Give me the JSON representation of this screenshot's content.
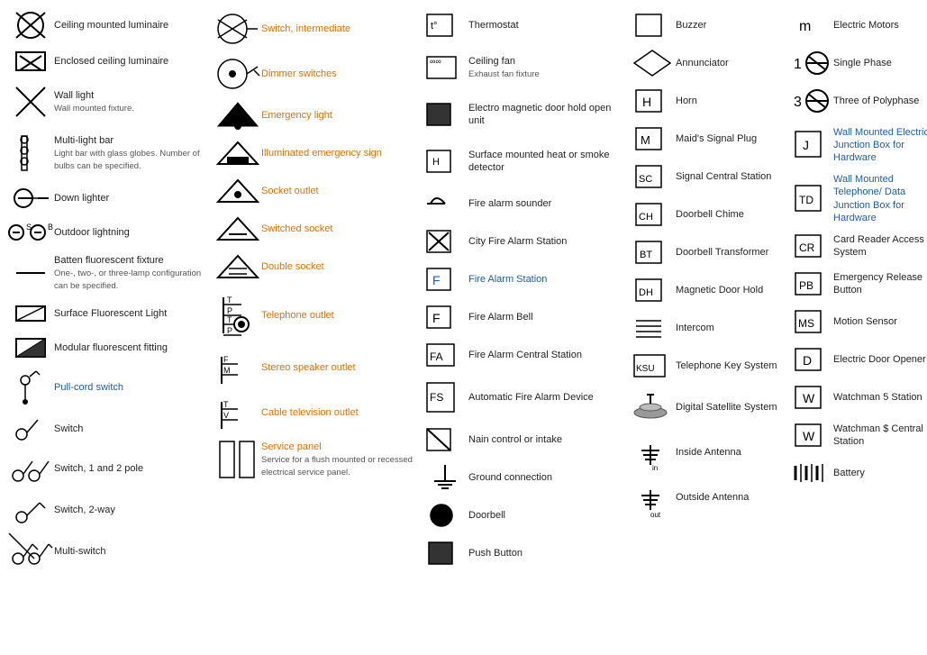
{
  "columns": [
    {
      "id": "col1",
      "items": [
        {
          "id": "ceiling-luminaire",
          "label": "Ceiling mounted luminaire",
          "sub": "",
          "labelColor": "black",
          "symbolType": "x-circle"
        },
        {
          "id": "enclosed-ceiling",
          "label": "Enclosed ceiling luminaire",
          "sub": "",
          "labelColor": "black",
          "symbolType": "x-rect"
        },
        {
          "id": "wall-light",
          "label": "Wall light",
          "sub": "Wall mounted fixture.",
          "labelColor": "black",
          "symbolType": "wall-light"
        },
        {
          "id": "multi-light-bar",
          "label": "Multi-light bar",
          "sub": "Light bar with glass globes. Number of bulbs can be specified.",
          "labelColor": "black",
          "symbolType": "multi-light"
        },
        {
          "id": "down-lighter",
          "label": "Down lighter",
          "sub": "",
          "labelColor": "black",
          "symbolType": "down-lighter"
        },
        {
          "id": "outdoor-lightning",
          "label": "Outdoor lightning",
          "sub": "",
          "labelColor": "black",
          "symbolType": "outdoor"
        },
        {
          "id": "batten-fluorescent",
          "label": "Batten fluorescent fixture",
          "sub": "One-, two-, or three-lamp configuration can be specified.",
          "labelColor": "black",
          "symbolType": "batten"
        },
        {
          "id": "surface-fluorescent",
          "label": "Surface Fluorescent Light",
          "sub": "",
          "labelColor": "black",
          "symbolType": "surface-fluor"
        },
        {
          "id": "modular-fluorescent",
          "label": "Modular fluorescent fitting",
          "sub": "",
          "labelColor": "black",
          "symbolType": "modular-fluor"
        },
        {
          "id": "pull-cord",
          "label": "Pull-cord switch",
          "sub": "",
          "labelColor": "blue",
          "symbolType": "pull-cord"
        },
        {
          "id": "switch",
          "label": "Switch",
          "sub": "",
          "labelColor": "black",
          "symbolType": "switch-single"
        },
        {
          "id": "switch-1-2-pole",
          "label": "Switch, 1 and 2 pole",
          "sub": "",
          "labelColor": "black",
          "symbolType": "switch-1-2"
        },
        {
          "id": "switch-2way",
          "label": "Switch, 2-way",
          "sub": "",
          "labelColor": "black",
          "symbolType": "switch-2way"
        },
        {
          "id": "multi-switch",
          "label": "Multi-switch",
          "sub": "",
          "labelColor": "black",
          "symbolType": "multi-switch"
        }
      ]
    },
    {
      "id": "col2",
      "items": [
        {
          "id": "switch-intermediate",
          "label": "Switch, intermediate",
          "sub": "",
          "labelColor": "orange",
          "symbolType": "switch-intermediate"
        },
        {
          "id": "dimmer-switches",
          "label": "Dimmer switches",
          "sub": "",
          "labelColor": "orange",
          "symbolType": "dimmer"
        },
        {
          "id": "emergency-light",
          "label": "Emergency light",
          "sub": "",
          "labelColor": "orange",
          "symbolType": "emergency-light"
        },
        {
          "id": "illuminated-emergency",
          "label": "Illuminated emergency sign",
          "sub": "",
          "labelColor": "orange",
          "symbolType": "illuminated-emergency"
        },
        {
          "id": "socket-outlet",
          "label": "Socket outlet",
          "sub": "",
          "labelColor": "orange",
          "symbolType": "socket-outlet"
        },
        {
          "id": "switched-socket",
          "label": "Switched socket",
          "sub": "",
          "labelColor": "orange",
          "symbolType": "switched-socket"
        },
        {
          "id": "double-socket",
          "label": "Double socket",
          "sub": "",
          "labelColor": "orange",
          "symbolType": "double-socket"
        },
        {
          "id": "telephone-outlet",
          "label": "Telephone outlet",
          "sub": "",
          "labelColor": "orange",
          "symbolType": "telephone-outlet"
        },
        {
          "id": "stereo-speaker",
          "label": "Stereo speaker outlet",
          "sub": "",
          "labelColor": "orange",
          "symbolType": "stereo-speaker"
        },
        {
          "id": "cable-tv",
          "label": "Cable television outlet",
          "sub": "",
          "labelColor": "orange",
          "symbolType": "cable-tv"
        },
        {
          "id": "service-panel",
          "label": "Service panel",
          "sub": "Service for a flush mounted or recessed electrical service panel.",
          "labelColor": "orange",
          "symbolType": "service-panel"
        }
      ]
    },
    {
      "id": "col3",
      "items": [
        {
          "id": "thermostat",
          "label": "Thermostat",
          "sub": "",
          "labelColor": "black",
          "symbolType": "thermostat"
        },
        {
          "id": "ceiling-fan",
          "label": "Ceiling fan",
          "sub": "Exhaust fan fixture",
          "labelColor": "black",
          "symbolType": "ceiling-fan"
        },
        {
          "id": "electro-magnetic",
          "label": "Electro magnetic door hold open unit",
          "sub": "",
          "labelColor": "black",
          "symbolType": "electro-magnetic"
        },
        {
          "id": "surface-heat-smoke",
          "label": "Surface mounted heat or smoke detector",
          "sub": "",
          "labelColor": "black",
          "symbolType": "surface-heat"
        },
        {
          "id": "fire-alarm-sounder",
          "label": "Fire alarm sounder",
          "sub": "",
          "labelColor": "black",
          "symbolType": "fire-alarm-sounder"
        },
        {
          "id": "city-fire-alarm",
          "label": "City Fire Alarm Station",
          "sub": "",
          "labelColor": "black",
          "symbolType": "city-fire"
        },
        {
          "id": "fire-alarm-station",
          "label": "Fire Alarm Station",
          "sub": "",
          "labelColor": "blue",
          "symbolType": "fire-station"
        },
        {
          "id": "fire-alarm-bell",
          "label": "Fire Alarm Bell",
          "sub": "",
          "labelColor": "black",
          "symbolType": "fire-bell"
        },
        {
          "id": "fire-alarm-central",
          "label": "Fire Alarm Central Station",
          "sub": "",
          "labelColor": "black",
          "symbolType": "fire-central"
        },
        {
          "id": "auto-fire-alarm",
          "label": "Automatic Fire Alarm Device",
          "sub": "",
          "labelColor": "black",
          "symbolType": "auto-fire"
        },
        {
          "id": "main-control",
          "label": "Nain control or intake",
          "sub": "",
          "labelColor": "black",
          "symbolType": "main-control"
        },
        {
          "id": "ground-connection",
          "label": "Ground connection",
          "sub": "",
          "labelColor": "black",
          "symbolType": "ground"
        },
        {
          "id": "doorbell",
          "label": "Doorbell",
          "sub": "",
          "labelColor": "black",
          "symbolType": "doorbell"
        },
        {
          "id": "push-button",
          "label": "Push Button",
          "sub": "",
          "labelColor": "black",
          "symbolType": "push-button"
        }
      ]
    },
    {
      "id": "col4",
      "items": [
        {
          "id": "buzzer",
          "label": "Buzzer",
          "sub": "",
          "labelColor": "black",
          "symbolType": "buzzer"
        },
        {
          "id": "annunciator",
          "label": "Annunciator",
          "sub": "",
          "labelColor": "black",
          "symbolType": "annunciator"
        },
        {
          "id": "horn",
          "label": "Horn",
          "sub": "",
          "labelColor": "black",
          "symbolType": "horn"
        },
        {
          "id": "maids-signal",
          "label": "Maid's Signal Plug",
          "sub": "",
          "labelColor": "black",
          "symbolType": "maids-signal"
        },
        {
          "id": "signal-central",
          "label": "Signal Central Station",
          "sub": "",
          "labelColor": "black",
          "symbolType": "signal-central"
        },
        {
          "id": "doorbell-chime",
          "label": "Doorbell Chime",
          "sub": "",
          "labelColor": "black",
          "symbolType": "doorbell-chime"
        },
        {
          "id": "doorbell-transformer",
          "label": "Doorbell Transformer",
          "sub": "",
          "labelColor": "black",
          "symbolType": "doorbell-transformer"
        },
        {
          "id": "magnetic-door",
          "label": "Magnetic Door Hold",
          "sub": "",
          "labelColor": "black",
          "symbolType": "magnetic-door"
        },
        {
          "id": "intercom",
          "label": "Intercom",
          "sub": "",
          "labelColor": "black",
          "symbolType": "intercom"
        },
        {
          "id": "telephone-key",
          "label": "Telephone Key System",
          "sub": "",
          "labelColor": "black",
          "symbolType": "telephone-key"
        },
        {
          "id": "digital-satellite",
          "label": "Digital Satellite System",
          "sub": "",
          "labelColor": "black",
          "symbolType": "digital-satellite"
        },
        {
          "id": "inside-antenna",
          "label": "Inside Antenna",
          "sub": "",
          "labelColor": "black",
          "symbolType": "inside-antenna"
        },
        {
          "id": "outside-antenna",
          "label": "Outside Antenna",
          "sub": "",
          "labelColor": "black",
          "symbolType": "outside-antenna"
        }
      ]
    },
    {
      "id": "col5",
      "items": [
        {
          "id": "electric-motors",
          "label": "Electric Motors",
          "sub": "",
          "labelColor": "black",
          "symbolType": "electric-motors"
        },
        {
          "id": "single-phase",
          "label": "Single Phase",
          "sub": "",
          "labelColor": "black",
          "symbolType": "single-phase"
        },
        {
          "id": "three-polyphase",
          "label": "Three of Polyphase",
          "sub": "",
          "labelColor": "black",
          "symbolType": "three-polyphase"
        },
        {
          "id": "wall-junction-hardware",
          "label": "Wall Mounted Electrical Junction Box for Hardware",
          "sub": "",
          "labelColor": "blue",
          "symbolType": "wall-junction-j"
        },
        {
          "id": "wall-telephone-data",
          "label": "Wall Mounted Telephone/ Data Junction Box for Hardware",
          "sub": "",
          "labelColor": "blue",
          "symbolType": "wall-junction-td"
        },
        {
          "id": "card-reader",
          "label": "Card Reader Access System",
          "sub": "",
          "labelColor": "black",
          "symbolType": "card-reader"
        },
        {
          "id": "emergency-release",
          "label": "Emergency Release Button",
          "sub": "",
          "labelColor": "black",
          "symbolType": "emergency-release"
        },
        {
          "id": "motion-sensor",
          "label": "Motion Sensor",
          "sub": "",
          "labelColor": "black",
          "symbolType": "motion-sensor"
        },
        {
          "id": "electric-door",
          "label": "Electric Door Opener",
          "sub": "",
          "labelColor": "black",
          "symbolType": "electric-door"
        },
        {
          "id": "watchman-station",
          "label": "Watchman's Station",
          "sub": "",
          "labelColor": "black",
          "symbolType": "watchman-station"
        },
        {
          "id": "watchman-central",
          "label": "Watchman's Central Station",
          "sub": "",
          "labelColor": "black",
          "symbolType": "watchman-central"
        },
        {
          "id": "battery",
          "label": "Battery",
          "sub": "",
          "labelColor": "black",
          "symbolType": "battery"
        }
      ]
    }
  ]
}
